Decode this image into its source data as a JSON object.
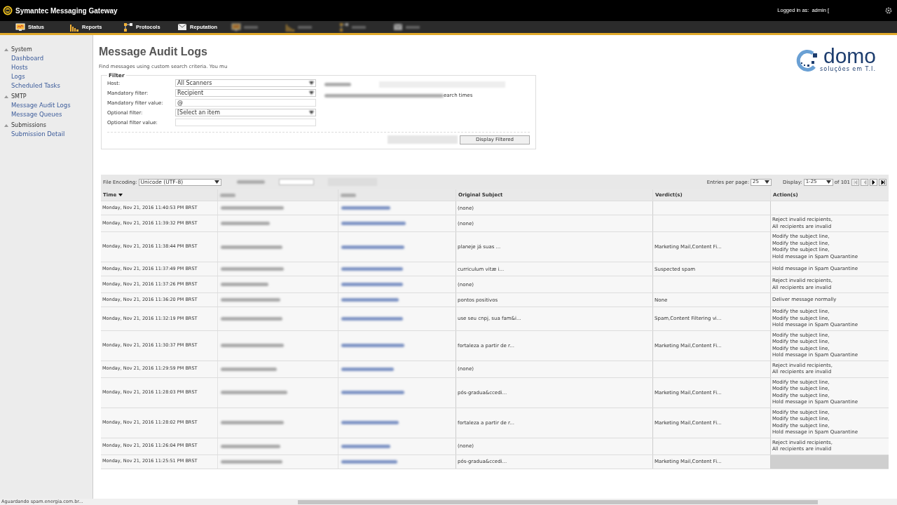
{
  "header": {
    "product": "Symantec Messaging Gateway",
    "logged_in_label": "Logged in as:",
    "user": "admin ["
  },
  "nav": [
    {
      "label": "Status"
    },
    {
      "label": "Reports"
    },
    {
      "label": "Protocols"
    },
    {
      "label": "Reputation"
    }
  ],
  "sidebar": [
    {
      "label": "System",
      "expanded": true,
      "children": [
        {
          "label": "Dashboard"
        },
        {
          "label": "Hosts"
        },
        {
          "label": "Logs"
        },
        {
          "label": "Scheduled Tasks"
        }
      ]
    },
    {
      "label": "SMTP",
      "expanded": true,
      "children": [
        {
          "label": "Message Audit Logs"
        },
        {
          "label": "Message Queues"
        }
      ]
    },
    {
      "label": "Submissions",
      "expanded": true,
      "children": [
        {
          "label": "Submission Detail"
        }
      ]
    }
  ],
  "page": {
    "title": "Message Audit Logs",
    "intro": "Find messages using custom search criteria. You mu"
  },
  "logo": {
    "name": "domo",
    "tagline": "soluções em T.I."
  },
  "filter": {
    "legend": "Filter",
    "fields": [
      {
        "label": "Host:",
        "kind": "select",
        "value": "All Scanners"
      },
      {
        "label": "Mandatory filter:",
        "kind": "select",
        "value": "Recipient"
      },
      {
        "label": "Mandatory filter value:",
        "kind": "input",
        "value": "@"
      },
      {
        "label": "Optional filter:",
        "kind": "select",
        "value": "[Select an item"
      },
      {
        "label": "Optional filter value:",
        "kind": "input"
      }
    ],
    "note": "earch times",
    "buttons": [
      "Display Filtered"
    ]
  },
  "toolbar": {
    "encoding_label": "File Encoding:",
    "encoding": "Unicode (UTF-8)",
    "entries_label": "Entries per page:",
    "entries": "25",
    "display_label": "Display:",
    "display": "1-25",
    "of": "of 101"
  },
  "table": {
    "columns": [
      {
        "label": "Time",
        "sorted": true
      },
      {
        "label": "Original Subject",
        "sorted": false
      },
      {
        "label": "Verdict(s)",
        "sorted": false
      },
      {
        "label": "Action(s)",
        "sorted": false
      }
    ],
    "rows": [
      {
        "time": "Monday, Nov 21, 2016 11:40:53 PM BRST",
        "subject": "(none)",
        "actions": [],
        "selected": false
      },
      {
        "time": "Monday, Nov 21, 2016 11:39:32 PM BRST",
        "subject": "(none)",
        "actions": [
          "Reject invalid recipients,",
          "All recipients are invalid"
        ],
        "selected": false
      },
      {
        "time": "Monday, Nov 21, 2016 11:38:44 PM BRST",
        "subject": "planeje já suas ...",
        "verdict": "Marketing Mail,Content Fi...",
        "actions": [
          "Modify the subject line,",
          "Modify the subject line,",
          "Modify the subject line,",
          "Hold message in Spam Quarantine"
        ],
        "selected": false
      },
      {
        "time": "Monday, Nov 21, 2016 11:37:49 PM BRST",
        "subject": "curriculum vitæ i...",
        "verdict": "Suspected spam",
        "actions": [
          "Hold message in Spam Quarantine"
        ],
        "selected": false
      },
      {
        "time": "Monday, Nov 21, 2016 11:37:26 PM BRST",
        "subject": "(none)",
        "actions": [
          "Reject invalid recipients,",
          "All recipients are invalid"
        ],
        "selected": false
      },
      {
        "time": "Monday, Nov 21, 2016 11:36:20 PM BRST",
        "subject": "pontos positivos",
        "verdict": "None",
        "actions": [
          "Deliver message normally"
        ],
        "selected": false
      },
      {
        "time": "Monday, Nov 21, 2016 11:32:19 PM BRST",
        "subject": "use seu cnpj, sua fam&i...",
        "verdict": "Spam,Content Filtering vi...",
        "actions": [
          "Modify the subject line,",
          "Modify the subject line,",
          "Hold message in Spam Quarantine"
        ],
        "selected": false
      },
      {
        "time": "Monday, Nov 21, 2016 11:30:37 PM BRST",
        "subject": "fortaleza a partir de r...",
        "verdict": "Marketing Mail,Content Fi...",
        "actions": [
          "Modify the subject line,",
          "Modify the subject line,",
          "Modify the subject line,",
          "Hold message in Spam Quarantine"
        ],
        "selected": false
      },
      {
        "time": "Monday, Nov 21, 2016 11:29:59 PM BRST",
        "subject": "(none)",
        "actions": [
          "Reject invalid recipients,",
          "All recipients are invalid"
        ],
        "selected": false
      },
      {
        "time": "Monday, Nov 21, 2016 11:28:03 PM BRST",
        "subject": "pós-gradua&ccedi...",
        "verdict": "Marketing Mail,Content Fi...",
        "actions": [
          "Modify the subject line,",
          "Modify the subject line,",
          "Modify the subject line,",
          "Hold message in Spam Quarantine"
        ],
        "selected": false
      },
      {
        "time": "Monday, Nov 21, 2016 11:28:02 PM BRST",
        "subject": "fortaleza a partir de r...",
        "verdict": "Marketing Mail,Content Fi...",
        "actions": [
          "Modify the subject line,",
          "Modify the subject line,",
          "Modify the subject line,",
          "Hold message in Spam Quarantine"
        ],
        "selected": false
      },
      {
        "time": "Monday, Nov 21, 2016 11:26:04 PM BRST",
        "subject": "(none)",
        "actions": [
          "Reject invalid recipients,",
          "All recipients are invalid"
        ],
        "selected": false
      },
      {
        "time": "Monday, Nov 21, 2016 11:25:51 PM BRST",
        "subject": "pós-gradua&ccedi...",
        "verdict": "Marketing Mail,Content Fi...",
        "actions": [],
        "selected": true
      }
    ]
  },
  "status_bar": "Aguardando spam.energia.com.br..."
}
